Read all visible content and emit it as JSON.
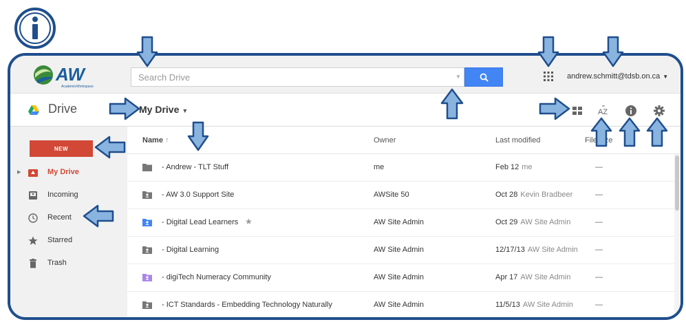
{
  "topbar": {
    "logo_text": "AW",
    "logo_subtext": "AcademicWorkspace",
    "search_placeholder": "Search Drive",
    "account_email": "andrew.schmitt@tdsb.on.ca"
  },
  "subbar": {
    "app_title": "Drive",
    "breadcrumb": "My Drive"
  },
  "sidebar": {
    "new_label": "NEW",
    "items": [
      {
        "label": "My Drive",
        "icon": "my-drive-icon",
        "active": true
      },
      {
        "label": "Incoming",
        "icon": "incoming-icon"
      },
      {
        "label": "Recent",
        "icon": "clock-icon"
      },
      {
        "label": "Starred",
        "icon": "star-icon"
      },
      {
        "label": "Trash",
        "icon": "trash-icon"
      }
    ]
  },
  "list": {
    "headers": {
      "name": "Name",
      "sort_indicator": "↑",
      "owner": "Owner",
      "modified": "Last modified",
      "size": "File size"
    },
    "rows": [
      {
        "name": "- Andrew - TLT Stuff",
        "owner": "me",
        "date": "Feb 12",
        "who": "me",
        "size": "—",
        "icon": "folder-icon"
      },
      {
        "name": "- AW 3.0 Support Site",
        "owner": "AWSite 50",
        "date": "Oct 28",
        "who": "Kevin Bradbeer",
        "size": "—",
        "icon": "shared-folder-icon"
      },
      {
        "name": "- Digital Lead Learners",
        "owner": "AW Site Admin",
        "date": "Oct 29",
        "who": "AW Site Admin",
        "size": "—",
        "icon": "shared-folder-blue-icon",
        "starred": true
      },
      {
        "name": "- Digital Learning",
        "owner": "AW Site Admin",
        "date": "12/17/13",
        "who": "AW Site Admin",
        "size": "—",
        "icon": "shared-folder-icon"
      },
      {
        "name": "- digiTech Numeracy Community",
        "owner": "AW Site Admin",
        "date": "Apr 17",
        "who": "AW Site Admin",
        "size": "—",
        "icon": "shared-folder-purple-icon"
      },
      {
        "name": "- ICT Standards - Embedding Technology Naturally",
        "owner": "AW Site Admin",
        "date": "11/5/13",
        "who": "AW Site Admin",
        "size": "—",
        "icon": "shared-folder-icon"
      }
    ]
  },
  "colors": {
    "frame": "#1f4e8c",
    "arrow_fill": "#8ab4e0",
    "arrow_stroke": "#1f4e8c",
    "new_button": "#d14836",
    "search_button": "#4285f4"
  }
}
